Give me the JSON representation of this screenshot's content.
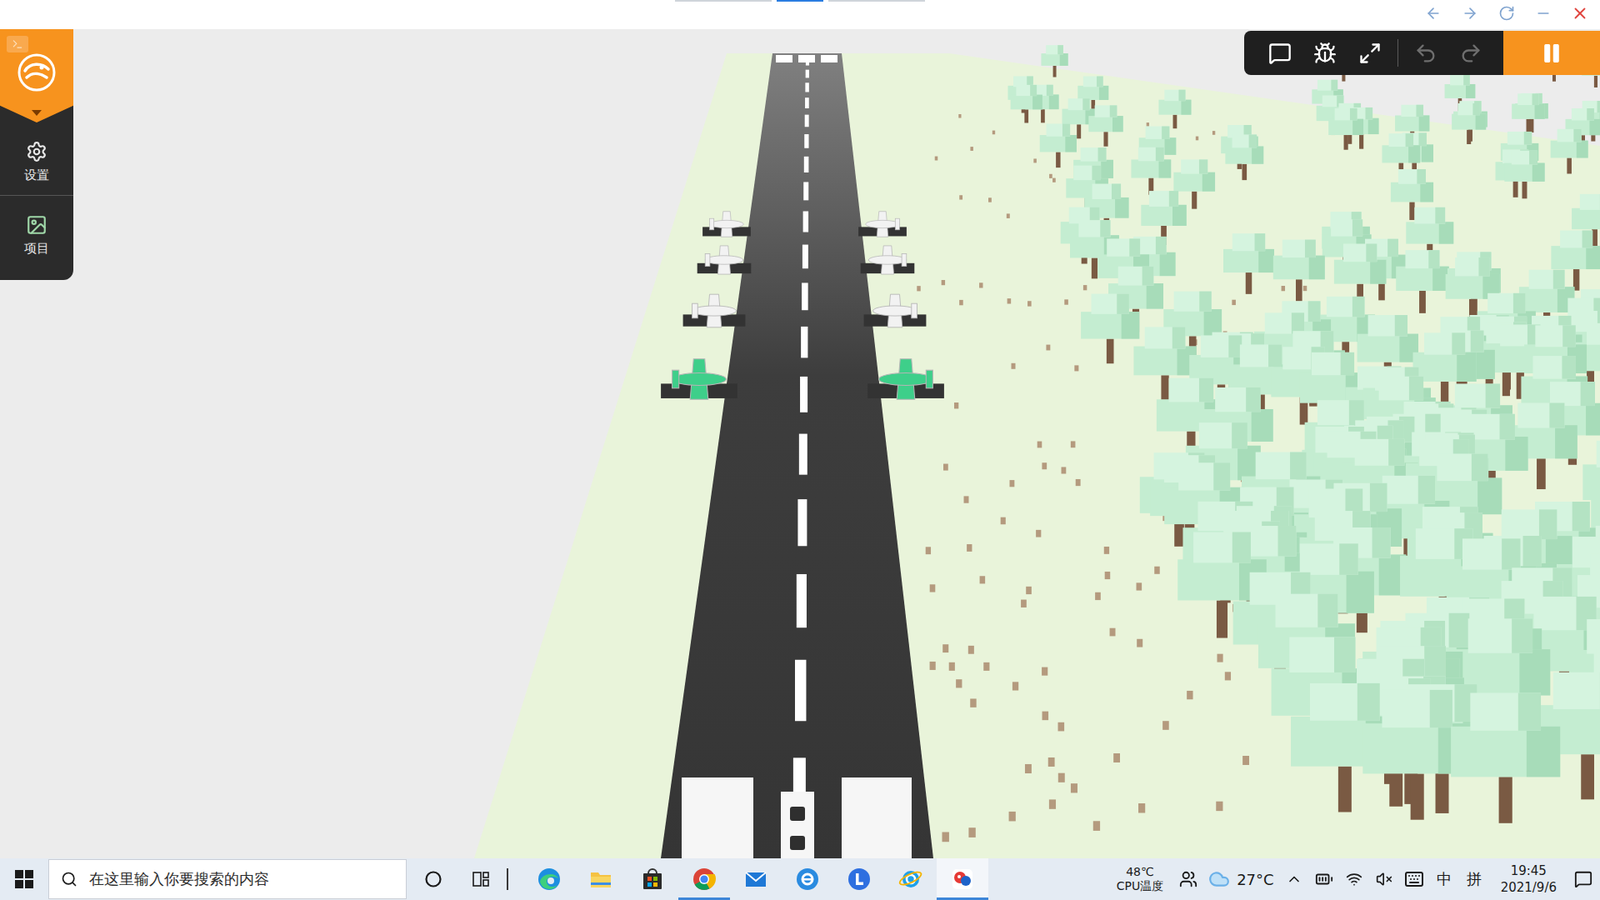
{
  "top_bar": {
    "tabs": [
      {
        "selected": false
      },
      {
        "selected": true
      },
      {
        "selected": false
      }
    ]
  },
  "sidebar": {
    "items": [
      {
        "label": "设置",
        "kind": "settings"
      },
      {
        "label": "项目",
        "kind": "project"
      }
    ]
  },
  "toolbar": {
    "buttons": [
      {
        "kind": "comment",
        "disabled": false
      },
      {
        "kind": "debug",
        "disabled": false
      },
      {
        "kind": "fullscreen",
        "disabled": false
      },
      {
        "kind": "undo",
        "disabled": true
      },
      {
        "kind": "redo",
        "disabled": true
      }
    ],
    "run": {
      "playing": true
    }
  },
  "scene": {
    "planes": [
      {
        "color": "#f2f2f2"
      },
      {
        "color": "#f2f2f2"
      },
      {
        "color": "#f2f2f2"
      },
      {
        "color": "#f2f2f2"
      },
      {
        "color": "#f2f2f2"
      },
      {
        "color": "#f2f2f2"
      },
      {
        "color": "#3ecf8a"
      },
      {
        "color": "#3ecf8a"
      }
    ]
  },
  "taskbar": {
    "search": {
      "placeholder": "在这里输入你要搜索的内容"
    },
    "apps": [
      {
        "kind": "edge",
        "running": false,
        "active": false
      },
      {
        "kind": "explorer",
        "running": false,
        "active": false
      },
      {
        "kind": "store",
        "running": false,
        "active": false
      },
      {
        "kind": "chrome",
        "running": true,
        "active": false
      },
      {
        "kind": "mail",
        "running": false,
        "active": false
      },
      {
        "kind": "ebrowser",
        "running": false,
        "active": false
      },
      {
        "kind": "lapp",
        "running": false,
        "active": false
      },
      {
        "kind": "ie",
        "running": false,
        "active": false
      },
      {
        "kind": "editor",
        "running": true,
        "active": true
      }
    ],
    "cpu": {
      "temp": "48℃",
      "label": "CPU温度"
    },
    "weather": {
      "temp": "27°C"
    },
    "ime": [
      "中",
      "拼"
    ],
    "clock": {
      "time": "19:45",
      "date": "2021/9/6"
    }
  }
}
